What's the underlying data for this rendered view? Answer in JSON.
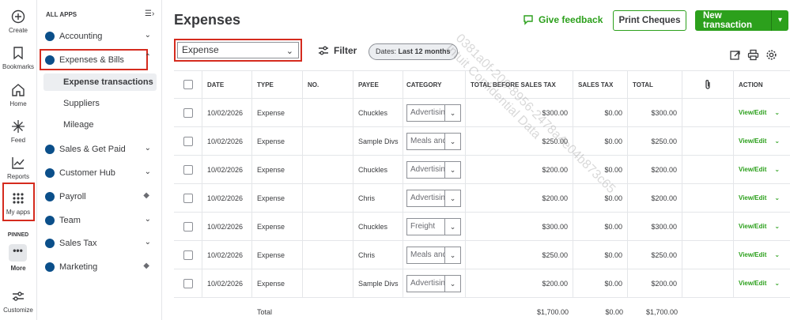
{
  "rail": {
    "create": "Create",
    "bookmarks": "Bookmarks",
    "home": "Home",
    "feed": "Feed",
    "reports": "Reports",
    "my_apps": "My apps",
    "pinned": "PINNED",
    "more": "More",
    "customize": "Customize"
  },
  "nav": {
    "header": "ALL APPS",
    "items": [
      {
        "label": "Accounting",
        "color": "#0b4f8a"
      },
      {
        "label": "Expenses & Bills",
        "color": "#0b4f8a"
      },
      {
        "label": "Sales & Get Paid",
        "color": "#0b4f8a"
      },
      {
        "label": "Customer Hub",
        "color": "#0b4f8a"
      },
      {
        "label": "Payroll",
        "color": "#0b4f8a"
      },
      {
        "label": "Team",
        "color": "#0b4f8a"
      },
      {
        "label": "Sales Tax",
        "color": "#0b4f8a"
      },
      {
        "label": "Marketing",
        "color": "#0b4f8a"
      }
    ],
    "sub_items": [
      "Expense transactions",
      "Suppliers",
      "Mileage"
    ]
  },
  "header": {
    "title": "Expenses",
    "feedback": "Give feedback",
    "print_cheques": "Print Cheques",
    "new_transaction": "New transaction"
  },
  "filters": {
    "type_value": "Expense",
    "filter_label": "Filter",
    "dates_prefix": "Dates:",
    "dates_value": "Last 12 months"
  },
  "table": {
    "columns": [
      "DATE",
      "TYPE",
      "NO.",
      "PAYEE",
      "CATEGORY",
      "TOTAL BEFORE SALES TAX",
      "SALES TAX",
      "TOTAL",
      "ACTION"
    ],
    "rows": [
      {
        "date": "10/02/2026",
        "type": "Expense",
        "no": "",
        "payee": "Chuckles",
        "category": "Advertising",
        "before": "$300.00",
        "tax": "$0.00",
        "total": "$300.00",
        "action": "View/Edit"
      },
      {
        "date": "10/02/2026",
        "type": "Expense",
        "no": "",
        "payee": "Sample Divs",
        "category": "Meals and",
        "before": "$250.00",
        "tax": "$0.00",
        "total": "$250.00",
        "action": "View/Edit"
      },
      {
        "date": "10/02/2026",
        "type": "Expense",
        "no": "",
        "payee": "Chuckles",
        "category": "Advertising",
        "before": "$200.00",
        "tax": "$0.00",
        "total": "$200.00",
        "action": "View/Edit"
      },
      {
        "date": "10/02/2026",
        "type": "Expense",
        "no": "",
        "payee": "Chris",
        "category": "Advertising",
        "before": "$200.00",
        "tax": "$0.00",
        "total": "$200.00",
        "action": "View/Edit"
      },
      {
        "date": "10/02/2026",
        "type": "Expense",
        "no": "",
        "payee": "Chuckles",
        "category": "Freight",
        "before": "$300.00",
        "tax": "$0.00",
        "total": "$300.00",
        "action": "View/Edit"
      },
      {
        "date": "10/02/2026",
        "type": "Expense",
        "no": "",
        "payee": "Chris",
        "category": "Meals and",
        "before": "$250.00",
        "tax": "$0.00",
        "total": "$250.00",
        "action": "View/Edit"
      },
      {
        "date": "10/02/2026",
        "type": "Expense",
        "no": "",
        "payee": "Sample Divs",
        "category": "Advertising",
        "before": "$200.00",
        "tax": "$0.00",
        "total": "$200.00",
        "action": "View/Edit"
      }
    ],
    "footer": {
      "label": "Total",
      "before": "$1,700.00",
      "tax": "$0.00",
      "total": "$1,700.00"
    }
  },
  "watermark": {
    "line1": "0381a0f-206-8956-2478a4e04b873c65",
    "line2": "Intuit Confidential Data"
  },
  "colors": {
    "accent": "#2ca01c",
    "highlight": "#d52b1e"
  }
}
